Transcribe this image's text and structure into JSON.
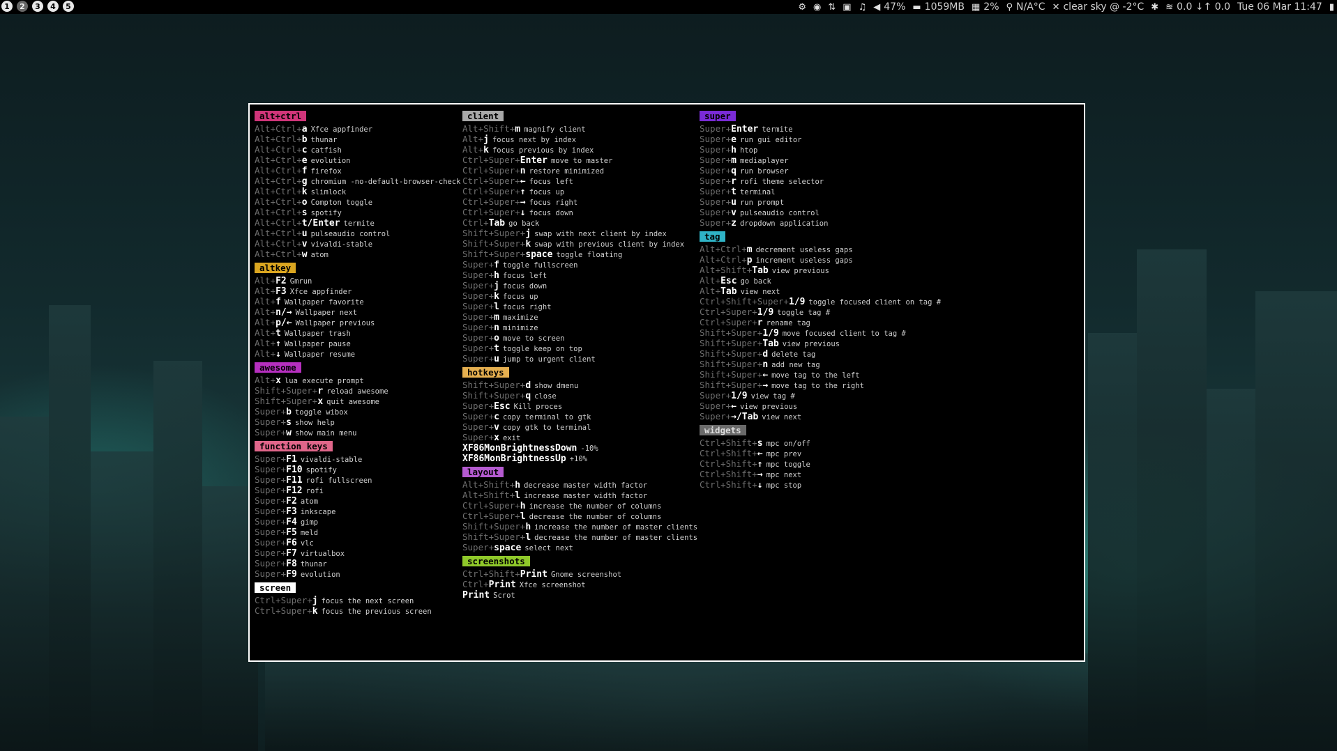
{
  "topbar": {
    "tags": [
      "1",
      "2",
      "3",
      "4",
      "5"
    ],
    "active_tag": "2",
    "widgets": {
      "volume": "47%",
      "memory": "1059MB",
      "cpu": "2%",
      "temperature": "N/A°C",
      "weather": "clear sky @ -2°C",
      "network": "0.0 ↓↑ 0.0",
      "clock": "Tue 06 Mar 11:47"
    }
  },
  "colors": {
    "alt+ctrl": "#d0357a",
    "altkey": "#daa520",
    "awesome": "#b62fbf",
    "function keys": "#e0668a",
    "screen": "#ffffff",
    "client": "#a8a8a8",
    "hotkeys": "#e6b050",
    "layout": "#b45ad0",
    "screenshots": "#8fc82a",
    "super": "#7a2bd6",
    "tag": "#2fb3c6",
    "widgets": "#6a6a6a"
  },
  "columns": [
    [
      {
        "name": "alt+ctrl",
        "items": [
          {
            "mod": "Alt+Ctrl+",
            "key": "a",
            "desc": "Xfce appfinder"
          },
          {
            "mod": "Alt+Ctrl+",
            "key": "b",
            "desc": "thunar"
          },
          {
            "mod": "Alt+Ctrl+",
            "key": "c",
            "desc": "catfish"
          },
          {
            "mod": "Alt+Ctrl+",
            "key": "e",
            "desc": "evolution"
          },
          {
            "mod": "Alt+Ctrl+",
            "key": "f",
            "desc": "firefox"
          },
          {
            "mod": "Alt+Ctrl+",
            "key": "g",
            "desc": "chromium -no-default-browser-check"
          },
          {
            "mod": "Alt+Ctrl+",
            "key": "k",
            "desc": "slimlock"
          },
          {
            "mod": "Alt+Ctrl+",
            "key": "o",
            "desc": "Compton toggle"
          },
          {
            "mod": "Alt+Ctrl+",
            "key": "s",
            "desc": "spotify"
          },
          {
            "mod": "Alt+Ctrl+",
            "key": "t/Enter",
            "desc": "termite"
          },
          {
            "mod": "Alt+Ctrl+",
            "key": "u",
            "desc": "pulseaudio control"
          },
          {
            "mod": "Alt+Ctrl+",
            "key": "v",
            "desc": "vivaldi-stable"
          },
          {
            "mod": "Alt+Ctrl+",
            "key": "w",
            "desc": "atom"
          }
        ]
      },
      {
        "name": "altkey",
        "items": [
          {
            "mod": "Alt+",
            "key": "F2",
            "desc": "Gmrun"
          },
          {
            "mod": "Alt+",
            "key": "F3",
            "desc": "Xfce appfinder"
          },
          {
            "mod": "Alt+",
            "key": "f",
            "desc": "Wallpaper favorite"
          },
          {
            "mod": "Alt+",
            "key": "n/→",
            "desc": "Wallpaper next"
          },
          {
            "mod": "Alt+",
            "key": "p/←",
            "desc": "Wallpaper previous"
          },
          {
            "mod": "Alt+",
            "key": "t",
            "desc": "Wallpaper trash"
          },
          {
            "mod": "Alt+",
            "key": "↑",
            "desc": "Wallpaper pause"
          },
          {
            "mod": "Alt+",
            "key": "↓",
            "desc": "Wallpaper resume"
          }
        ]
      },
      {
        "name": "awesome",
        "items": [
          {
            "mod": "Alt+",
            "key": "x",
            "desc": "lua execute prompt"
          },
          {
            "mod": "Shift+Super+",
            "key": "r",
            "desc": "reload awesome"
          },
          {
            "mod": "Shift+Super+",
            "key": "x",
            "desc": "quit awesome"
          },
          {
            "mod": "Super+",
            "key": "b",
            "desc": "toggle wibox"
          },
          {
            "mod": "Super+",
            "key": "s",
            "desc": "show help"
          },
          {
            "mod": "Super+",
            "key": "w",
            "desc": "show main menu"
          }
        ]
      },
      {
        "name": "function keys",
        "items": [
          {
            "mod": "Super+",
            "key": "F1",
            "desc": "vivaldi-stable"
          },
          {
            "mod": "Super+",
            "key": "F10",
            "desc": "spotify"
          },
          {
            "mod": "Super+",
            "key": "F11",
            "desc": "rofi fullscreen"
          },
          {
            "mod": "Super+",
            "key": "F12",
            "desc": "rofi"
          },
          {
            "mod": "Super+",
            "key": "F2",
            "desc": "atom"
          },
          {
            "mod": "Super+",
            "key": "F3",
            "desc": "inkscape"
          },
          {
            "mod": "Super+",
            "key": "F4",
            "desc": "gimp"
          },
          {
            "mod": "Super+",
            "key": "F5",
            "desc": "meld"
          },
          {
            "mod": "Super+",
            "key": "F6",
            "desc": "vlc"
          },
          {
            "mod": "Super+",
            "key": "F7",
            "desc": "virtualbox"
          },
          {
            "mod": "Super+",
            "key": "F8",
            "desc": "thunar"
          },
          {
            "mod": "Super+",
            "key": "F9",
            "desc": "evolution"
          }
        ]
      },
      {
        "name": "screen",
        "items": [
          {
            "mod": "Ctrl+Super+",
            "key": "j",
            "desc": "focus the next screen"
          },
          {
            "mod": "Ctrl+Super+",
            "key": "k",
            "desc": "focus the previous screen"
          }
        ]
      }
    ],
    [
      {
        "name": "client",
        "items": [
          {
            "mod": "Alt+Shift+",
            "key": "m",
            "desc": "magnify client"
          },
          {
            "mod": "Alt+",
            "key": "j",
            "desc": "focus next by index"
          },
          {
            "mod": "Alt+",
            "key": "k",
            "desc": "focus previous by index"
          },
          {
            "mod": "Ctrl+Super+",
            "key": "Enter",
            "desc": "move to master"
          },
          {
            "mod": "Ctrl+Super+",
            "key": "n",
            "desc": "restore minimized"
          },
          {
            "mod": "Ctrl+Super+",
            "key": "←",
            "desc": "focus left"
          },
          {
            "mod": "Ctrl+Super+",
            "key": "↑",
            "desc": "focus up"
          },
          {
            "mod": "Ctrl+Super+",
            "key": "→",
            "desc": "focus right"
          },
          {
            "mod": "Ctrl+Super+",
            "key": "↓",
            "desc": "focus down"
          },
          {
            "mod": "Ctrl+",
            "key": "Tab",
            "desc": "go back"
          },
          {
            "mod": "Shift+Super+",
            "key": "j",
            "desc": "swap with next client by index"
          },
          {
            "mod": "Shift+Super+",
            "key": "k",
            "desc": "swap with previous client by index"
          },
          {
            "mod": "Shift+Super+",
            "key": "space",
            "desc": "toggle floating"
          },
          {
            "mod": "Super+",
            "key": "f",
            "desc": "toggle fullscreen"
          },
          {
            "mod": "Super+",
            "key": "h",
            "desc": "focus left"
          },
          {
            "mod": "Super+",
            "key": "j",
            "desc": "focus down"
          },
          {
            "mod": "Super+",
            "key": "k",
            "desc": "focus up"
          },
          {
            "mod": "Super+",
            "key": "l",
            "desc": "focus right"
          },
          {
            "mod": "Super+",
            "key": "m",
            "desc": "maximize"
          },
          {
            "mod": "Super+",
            "key": "n",
            "desc": "minimize"
          },
          {
            "mod": "Super+",
            "key": "o",
            "desc": "move to screen"
          },
          {
            "mod": "Super+",
            "key": "t",
            "desc": "toggle keep on top"
          },
          {
            "mod": "Super+",
            "key": "u",
            "desc": "jump to urgent client"
          }
        ]
      },
      {
        "name": "hotkeys",
        "items": [
          {
            "mod": "Shift+Super+",
            "key": "d",
            "desc": "show dmenu"
          },
          {
            "mod": "Shift+Super+",
            "key": "q",
            "desc": "close"
          },
          {
            "mod": "Super+",
            "key": "Esc",
            "desc": "Kill proces"
          },
          {
            "mod": "Super+",
            "key": "c",
            "desc": "copy terminal to gtk"
          },
          {
            "mod": "Super+",
            "key": "v",
            "desc": "copy gtk to terminal"
          },
          {
            "mod": "Super+",
            "key": "x",
            "desc": "exit"
          },
          {
            "mod": "",
            "key": "XF86MonBrightnessDown",
            "desc": "-10%"
          },
          {
            "mod": "",
            "key": "XF86MonBrightnessUp",
            "desc": "+10%"
          }
        ]
      },
      {
        "name": "layout",
        "items": [
          {
            "mod": "Alt+Shift+",
            "key": "h",
            "desc": "decrease master width factor"
          },
          {
            "mod": "Alt+Shift+",
            "key": "l",
            "desc": "increase master width factor"
          },
          {
            "mod": "Ctrl+Super+",
            "key": "h",
            "desc": "increase the number of columns"
          },
          {
            "mod": "Ctrl+Super+",
            "key": "l",
            "desc": "decrease the number of columns"
          },
          {
            "mod": "Shift+Super+",
            "key": "h",
            "desc": "increase the number of master clients"
          },
          {
            "mod": "Shift+Super+",
            "key": "l",
            "desc": "decrease the number of master clients"
          },
          {
            "mod": "Super+",
            "key": "space",
            "desc": "select next"
          }
        ]
      },
      {
        "name": "screenshots",
        "items": [
          {
            "mod": "Ctrl+Shift+",
            "key": "Print",
            "desc": "Gnome screenshot"
          },
          {
            "mod": "Ctrl+",
            "key": "Print",
            "desc": "Xfce screenshot"
          },
          {
            "mod": "",
            "key": "Print",
            "desc": "Scrot"
          }
        ]
      }
    ],
    [
      {
        "name": "super",
        "items": [
          {
            "mod": "Super+",
            "key": "Enter",
            "desc": "termite"
          },
          {
            "mod": "Super+",
            "key": "e",
            "desc": "run gui editor"
          },
          {
            "mod": "Super+",
            "key": "h",
            "desc": "htop"
          },
          {
            "mod": "Super+",
            "key": "m",
            "desc": "mediaplayer"
          },
          {
            "mod": "Super+",
            "key": "q",
            "desc": "run browser"
          },
          {
            "mod": "Super+",
            "key": "r",
            "desc": "rofi theme selector"
          },
          {
            "mod": "Super+",
            "key": "t",
            "desc": "terminal"
          },
          {
            "mod": "Super+",
            "key": "u",
            "desc": "run prompt"
          },
          {
            "mod": "Super+",
            "key": "v",
            "desc": "pulseaudio control"
          },
          {
            "mod": "Super+",
            "key": "z",
            "desc": "dropdown application"
          }
        ]
      },
      {
        "name": "tag",
        "items": [
          {
            "mod": "Alt+Ctrl+",
            "key": "m",
            "desc": "decrement useless gaps"
          },
          {
            "mod": "Alt+Ctrl+",
            "key": "p",
            "desc": "increment useless gaps"
          },
          {
            "mod": "Alt+Shift+",
            "key": "Tab",
            "desc": "view previous"
          },
          {
            "mod": "Alt+",
            "key": "Esc",
            "desc": "go back"
          },
          {
            "mod": "Alt+",
            "key": "Tab",
            "desc": "view next"
          },
          {
            "mod": "Ctrl+Shift+Super+",
            "key": "1/9",
            "desc": "toggle focused client on tag #"
          },
          {
            "mod": "Ctrl+Super+",
            "key": "1/9",
            "desc": "toggle tag #"
          },
          {
            "mod": "Ctrl+Super+",
            "key": "r",
            "desc": "rename tag"
          },
          {
            "mod": "Shift+Super+",
            "key": "1/9",
            "desc": "move focused client to tag #"
          },
          {
            "mod": "Shift+Super+",
            "key": "Tab",
            "desc": "view previous"
          },
          {
            "mod": "Shift+Super+",
            "key": "d",
            "desc": "delete tag"
          },
          {
            "mod": "Shift+Super+",
            "key": "n",
            "desc": "add new tag"
          },
          {
            "mod": "Shift+Super+",
            "key": "←",
            "desc": "move tag to the left"
          },
          {
            "mod": "Shift+Super+",
            "key": "→",
            "desc": "move tag to the right"
          },
          {
            "mod": "Super+",
            "key": "1/9",
            "desc": "view tag #"
          },
          {
            "mod": "Super+",
            "key": "←",
            "desc": "view previous"
          },
          {
            "mod": "Super+",
            "key": "→/Tab",
            "desc": "view next"
          }
        ]
      },
      {
        "name": "widgets",
        "items": [
          {
            "mod": "Ctrl+Shift+",
            "key": "s",
            "desc": "mpc on/off"
          },
          {
            "mod": "Ctrl+Shift+",
            "key": "←",
            "desc": "mpc prev"
          },
          {
            "mod": "Ctrl+Shift+",
            "key": "↑",
            "desc": "mpc toggle"
          },
          {
            "mod": "Ctrl+Shift+",
            "key": "→",
            "desc": "mpc next"
          },
          {
            "mod": "Ctrl+Shift+",
            "key": "↓",
            "desc": "mpc stop"
          }
        ]
      }
    ]
  ]
}
